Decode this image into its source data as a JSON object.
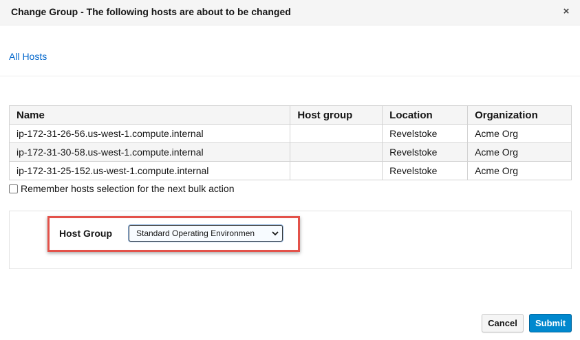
{
  "modal": {
    "title": "Change Group - The following hosts are about to be changed",
    "close_label": "×"
  },
  "breadcrumb": {
    "all_hosts": "All Hosts"
  },
  "table": {
    "headers": [
      "Name",
      "Host group",
      "Location",
      "Organization"
    ],
    "rows": [
      [
        "ip-172-31-26-56.us-west-1.compute.internal",
        "",
        "Revelstoke",
        "Acme Org"
      ],
      [
        "ip-172-31-30-58.us-west-1.compute.internal",
        "",
        "Revelstoke",
        "Acme Org"
      ],
      [
        "ip-172-31-25-152.us-west-1.compute.internal",
        "",
        "Revelstoke",
        "Acme Org"
      ]
    ]
  },
  "remember": {
    "label": "Remember hosts selection for the next bulk action",
    "checked": false
  },
  "form": {
    "host_group_label": "Host Group",
    "host_group_value": "Standard Operating Environment",
    "highlight_color": "#e3524a"
  },
  "actions": {
    "cancel": "Cancel",
    "submit": "Submit",
    "submit_color": "#0088ce"
  }
}
